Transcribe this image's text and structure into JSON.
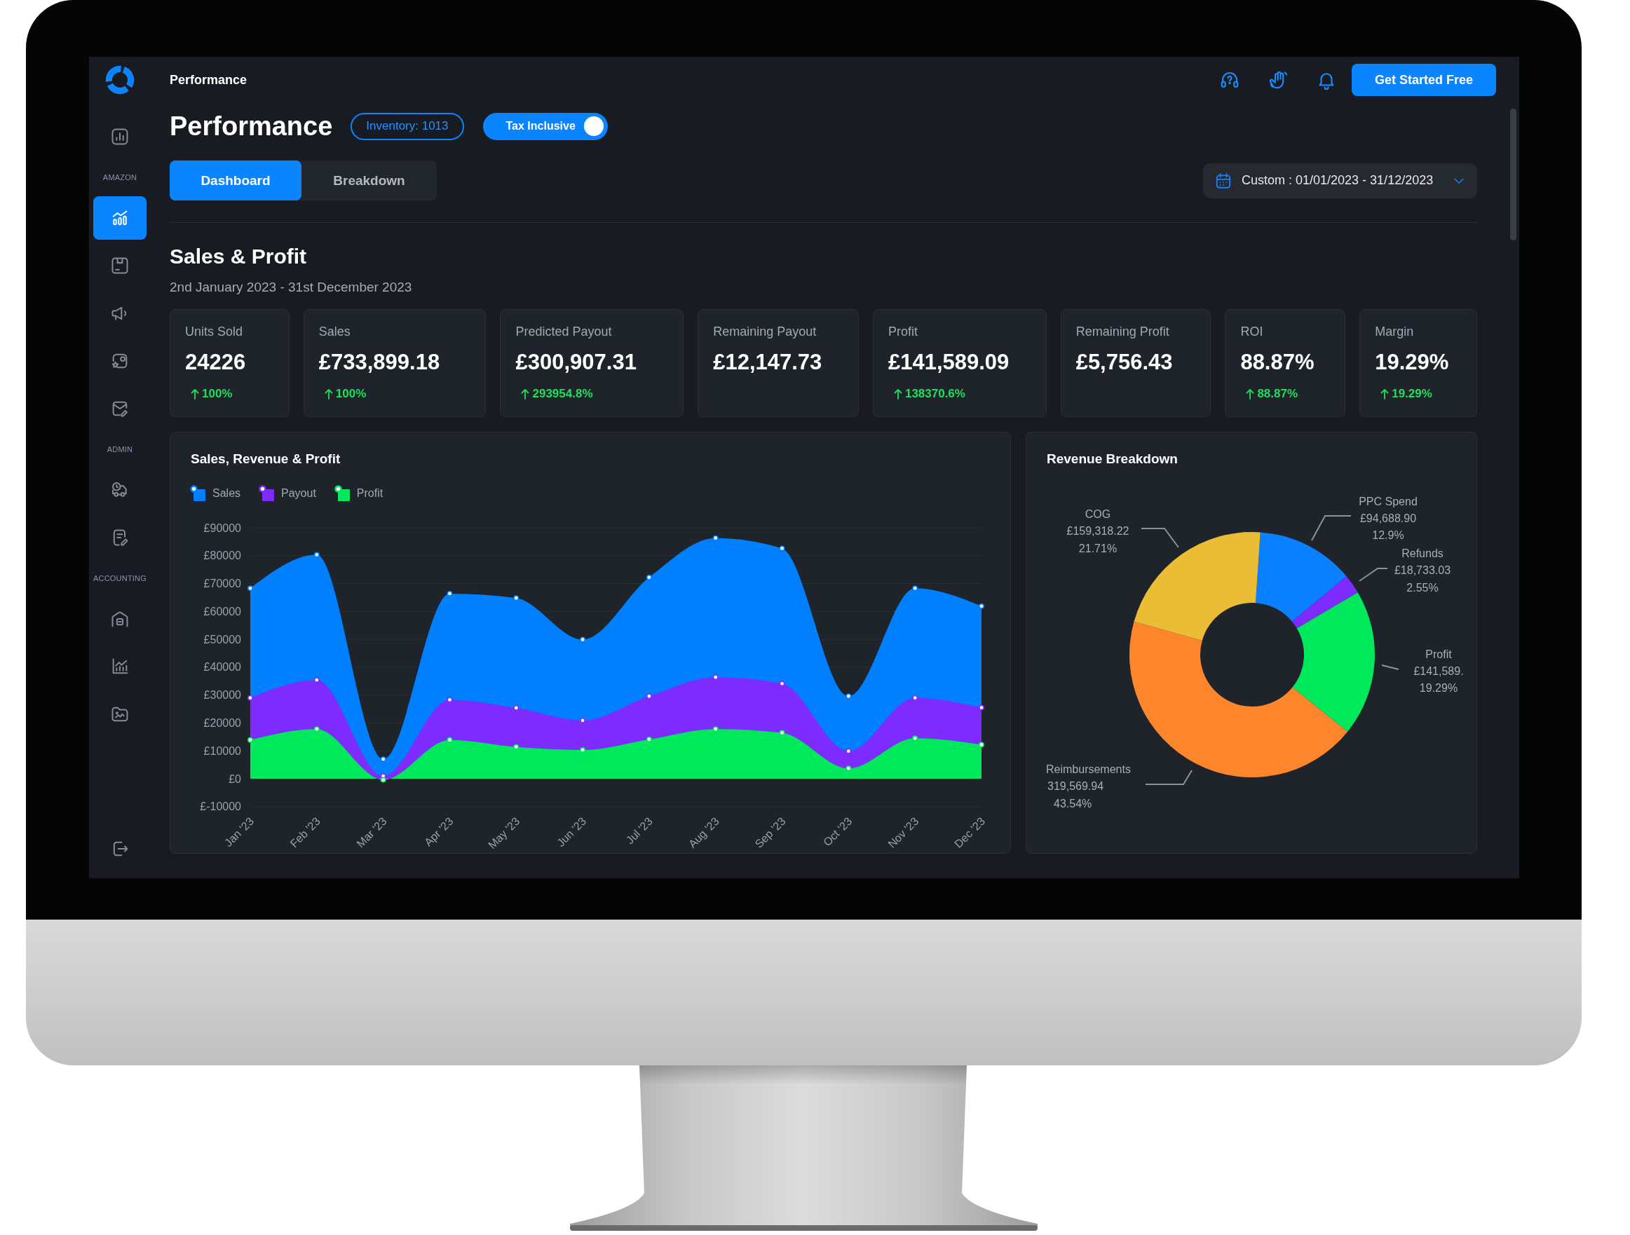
{
  "sidebar": {
    "sections": [
      {
        "items": [
          {
            "selected": false
          }
        ]
      },
      {
        "heading": "AMAZON",
        "items": [
          {
            "selected": true
          },
          {
            "selected": false
          },
          {
            "selected": false
          },
          {
            "selected": false
          },
          {
            "selected": false
          }
        ]
      },
      {
        "heading": "ADMIN",
        "items": [
          {
            "selected": false
          },
          {
            "selected": false
          }
        ]
      },
      {
        "heading": "ACCOUNTING",
        "items": [
          {
            "selected": false
          },
          {
            "selected": false
          },
          {
            "selected": false
          }
        ]
      }
    ]
  },
  "header": {
    "title": "Performance",
    "button": "Get Started Free"
  },
  "page": {
    "title": "Performance",
    "inventory_badge": "Inventory: 1013",
    "tax_toggle": {
      "label": "Tax Inclusive",
      "on": true
    }
  },
  "tabs": [
    {
      "label": "Dashboard",
      "selected": true
    },
    {
      "label": "Breakdown",
      "selected": false
    }
  ],
  "date_range": {
    "value": "Custom : 01/01/2023 - 31/12/2023"
  },
  "section": {
    "title": "Sales & Profit",
    "subtitle": "2nd January 2023 - 31st December 2023"
  },
  "kpis": [
    {
      "label": "Units Sold",
      "value": "24226",
      "change": "100%"
    },
    {
      "label": "Sales",
      "value": "£733,899.18",
      "change": "100%"
    },
    {
      "label": "Predicted Payout",
      "value": "£300,907.31",
      "change": "293954.8%"
    },
    {
      "label": "Remaining Payout",
      "value": "£12,147.73"
    },
    {
      "label": "Profit",
      "value": "£141,589.09",
      "change": "138370.6%"
    },
    {
      "label": "Remaining Profit",
      "value": "£5,756.43"
    },
    {
      "label": "ROI",
      "value": "88.87%",
      "change": "88.87%"
    },
    {
      "label": "Margin",
      "value": "19.29%",
      "change": "19.29%"
    }
  ],
  "sales_chart": {
    "chart_data": {
      "type": "area",
      "title": "Sales, Revenue & Profit",
      "categories": [
        "Jan '23",
        "Feb '23",
        "Mar '23",
        "Apr '23",
        "May '23",
        "Jun '23",
        "Jul '23",
        "Aug '23",
        "Sep '23",
        "Oct '23",
        "Nov '23",
        "Dec '23"
      ],
      "series": [
        {
          "name": "Sales",
          "color": "#0080ff",
          "values": [
            68300,
            80300,
            7000,
            66400,
            64800,
            49900,
            72200,
            86300,
            82600,
            29600,
            68300,
            61900
          ]
        },
        {
          "name": "Payout",
          "color": "#7e2bff",
          "values": [
            29000,
            35400,
            1000,
            28300,
            25400,
            20900,
            29600,
            36400,
            34100,
            9900,
            29000,
            25500
          ]
        },
        {
          "name": "Profit",
          "color": "#00e85c",
          "values": [
            13900,
            17800,
            -400,
            13900,
            11400,
            10300,
            14100,
            17800,
            16500,
            3700,
            14500,
            12200
          ]
        }
      ],
      "ylim": [
        -10000,
        90000
      ],
      "yticks": [
        {
          "value": -10000,
          "label": "£-10000"
        },
        {
          "value": 0,
          "label": "£0"
        },
        {
          "value": 10000,
          "label": "£10000"
        },
        {
          "value": 20000,
          "label": "£20000"
        },
        {
          "value": 30000,
          "label": "£30000"
        },
        {
          "value": 40000,
          "label": "£40000"
        },
        {
          "value": 50000,
          "label": "£50000"
        },
        {
          "value": 60000,
          "label": "£60000"
        },
        {
          "value": 70000,
          "label": "£70000"
        },
        {
          "value": 80000,
          "label": "£80000"
        },
        {
          "value": 90000,
          "label": "£90000"
        }
      ],
      "grid": true
    }
  },
  "revenue_chart": {
    "chart_data": {
      "type": "donut",
      "title": "Revenue Breakdown",
      "categories": [
        "PPC Spend",
        "Refunds",
        "Profit",
        "Reimbursements",
        "COG"
      ],
      "values": [
        94688.9,
        18733.03,
        141589.09,
        319569.94,
        159318.22
      ],
      "colors": [
        "#0a80ff",
        "#7e2bff",
        "#00e85c",
        "#fd862c",
        "#ebbd35"
      ],
      "value_labels": [
        "£94,688.90",
        "£18,733.03",
        "£141,589.",
        "319,569.94",
        "£159,318.22"
      ]
    },
    "percent_labels": [
      "12.9%",
      "2.55%",
      "19.29%",
      "43.54%",
      "21.71%"
    ]
  }
}
